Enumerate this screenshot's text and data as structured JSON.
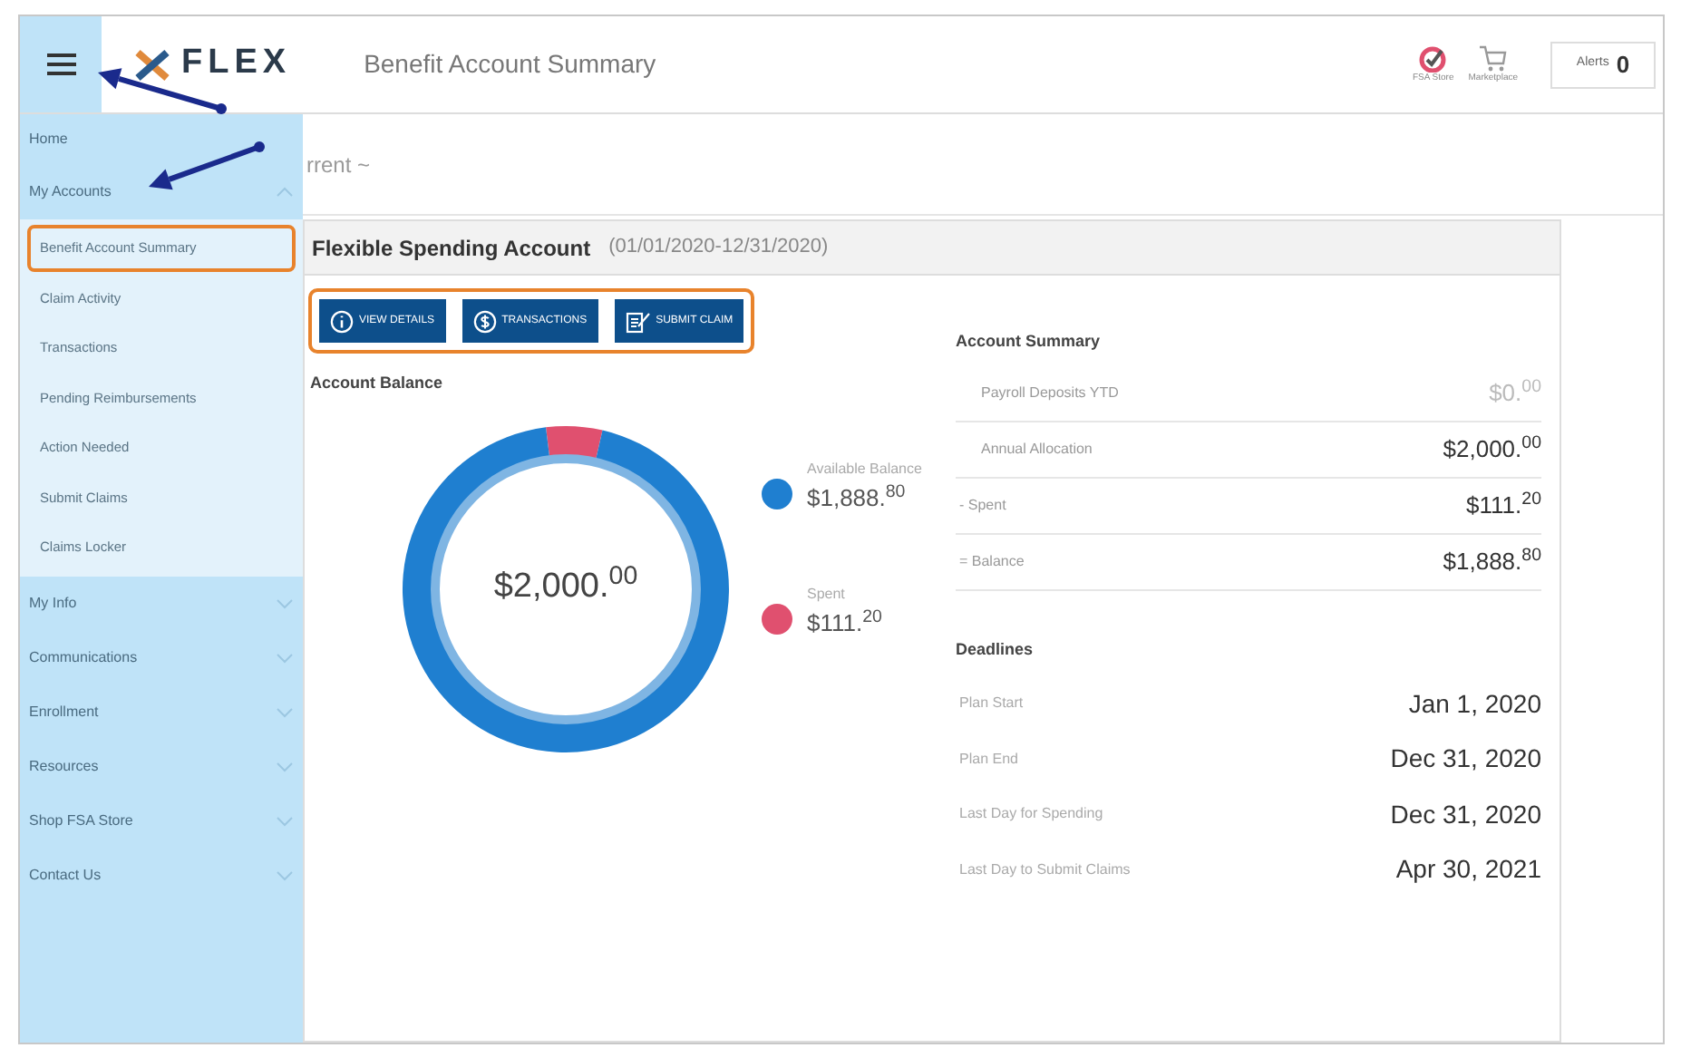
{
  "header": {
    "logo": "FLEX",
    "title": "Benefit Account Summary",
    "icons": [
      {
        "kind": "store",
        "label": "FSA Store"
      },
      {
        "kind": "cart",
        "label": "Marketplace"
      }
    ],
    "alerts": {
      "label": "Alerts",
      "count": "0"
    }
  },
  "sidebar": {
    "items": [
      {
        "label": "Home"
      },
      {
        "label": "My Accounts",
        "expanded": true,
        "children": [
          {
            "label": "Benefit Account Summary",
            "selected": true
          },
          {
            "label": "Claim Activity",
            "selected": false
          },
          {
            "label": "Transactions",
            "selected": false
          },
          {
            "label": "Pending Reimbursements",
            "selected": false
          },
          {
            "label": "Action Needed",
            "selected": false
          },
          {
            "label": "Submit Claims",
            "selected": false
          },
          {
            "label": "Claims Locker",
            "selected": false
          }
        ]
      },
      {
        "label": "My Info",
        "expanded": false
      },
      {
        "label": "Communications",
        "expanded": false
      },
      {
        "label": "Enrollment",
        "expanded": false
      },
      {
        "label": "Resources",
        "expanded": false
      },
      {
        "label": "Shop FSA Store",
        "expanded": false
      },
      {
        "label": "Contact Us",
        "expanded": false
      }
    ]
  },
  "breadcrumb": "rrent ~",
  "card": {
    "title": "Flexible Spending Account",
    "period": "(01/01/2020-12/31/2020)",
    "actions": [
      {
        "kind": "info",
        "label": "VIEW DETAILS"
      },
      {
        "kind": "dollar",
        "label": "TRANSACTIONS"
      },
      {
        "kind": "claim",
        "label": "SUBMIT CLAIM"
      }
    ],
    "balance": {
      "total": "$2,000.$^{00}$",
      "chart_data": {
        "type": "donut",
        "title": "Account Balance",
        "categories": [
          "Available Balance",
          "Spent"
        ],
        "values": [
          94.44,
          5.56
        ],
        "colors": [
          "#1f7fd0",
          "#e0506f"
        ]
      },
      "legend_amounts": [
        "$1,888.$^{80}$",
        "$111.$^{20}$"
      ]
    },
    "summary": {
      "title": "Account Summary",
      "rows": [
        {
          "label": "Payroll Deposits YTD",
          "value": "$0.$^{00}$",
          "muted": true
        },
        {
          "label": "Annual Allocation",
          "value": "$2,000.$^{00}$",
          "muted": false
        },
        {
          "label": "- Spent",
          "value": "$111.$^{20}$",
          "muted": false
        },
        {
          "label": "= Balance",
          "value": "$1,888.$^{80}$",
          "muted": false
        }
      ]
    },
    "deadlines": {
      "title": "Deadlines",
      "rows": [
        {
          "label": "Plan Start",
          "value": "Jan 1, 2020"
        },
        {
          "label": "Plan End",
          "value": "Dec 31, 2020"
        },
        {
          "label": "Last Day for Spending",
          "value": "Dec 31, 2020"
        },
        {
          "label": "Last Day to Submit Claims",
          "value": "Apr 30, 2021"
        }
      ]
    }
  },
  "annotations": {
    "actions_highlighted": true
  }
}
